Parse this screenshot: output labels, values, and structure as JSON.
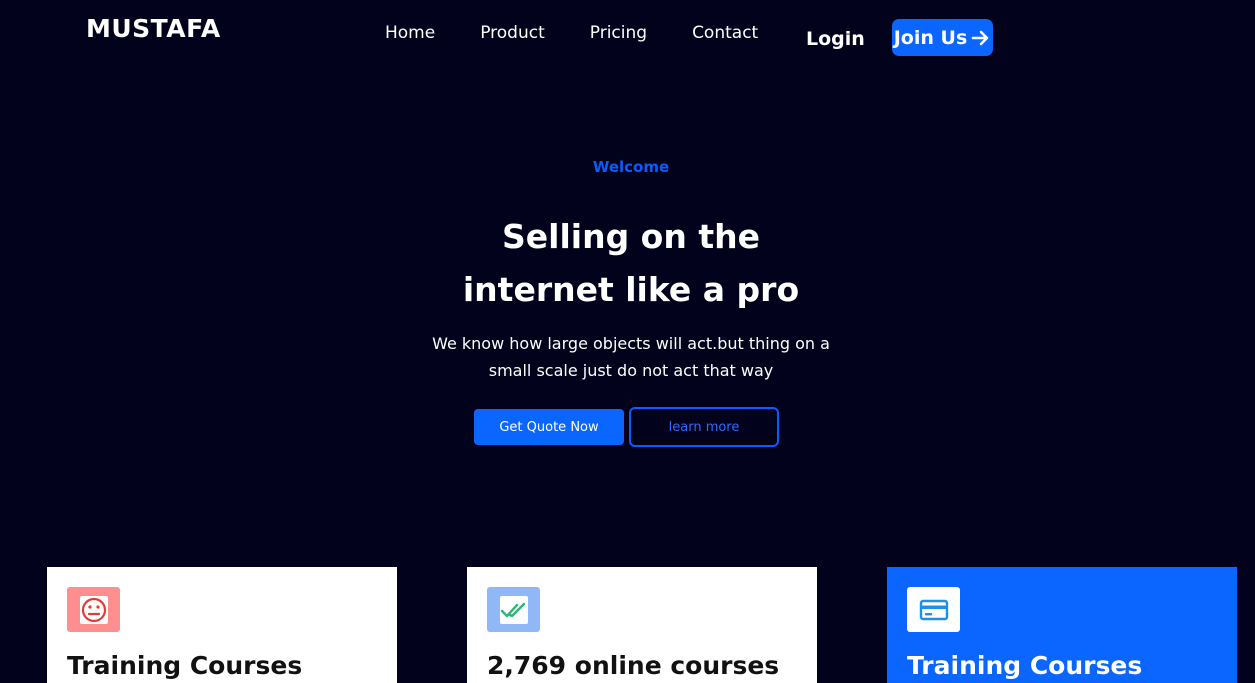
{
  "header": {
    "logo": "MUSTAFA",
    "nav": [
      "Home",
      "Product",
      "Pricing",
      "Contact"
    ],
    "login": "Login",
    "join": "Join Us"
  },
  "hero": {
    "eyebrow": "Welcome",
    "title_line1": "Selling on the",
    "title_line2": "internet like a pro",
    "subtitle_line1": "We know how large objects will act.but thing on a",
    "subtitle_line2": "small scale just do not act that way",
    "primary_button": "Get Quote Now",
    "secondary_button": "learn more"
  },
  "cards": [
    {
      "title": "Training Courses",
      "icon": "sad-face-icon"
    },
    {
      "title": "2,769 online courses",
      "icon": "double-check-icon"
    },
    {
      "title": "Training Courses",
      "icon": "credit-card-icon"
    }
  ],
  "colors": {
    "background": "#02021c",
    "accent": "#0a66ff",
    "card_icon_red": "#ff8f8f",
    "card_icon_blue": "#90b8f5"
  }
}
